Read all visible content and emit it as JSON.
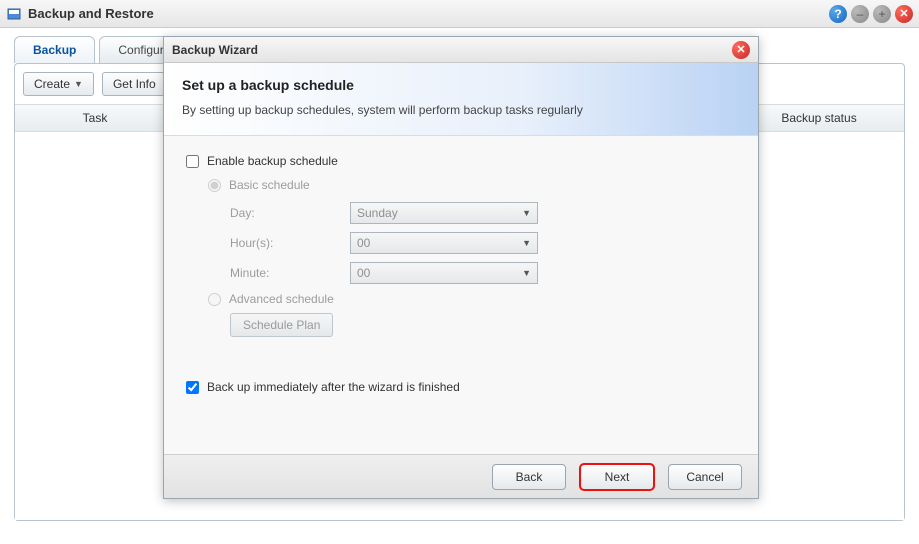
{
  "window": {
    "title": "Backup and Restore"
  },
  "tabs": {
    "backup": "Backup",
    "configure": "Configure"
  },
  "toolbar": {
    "create": "Create",
    "getinfo": "Get Info"
  },
  "table": {
    "col_task": "Task",
    "col_status": "Backup status"
  },
  "wizard": {
    "title": "Backup Wizard",
    "heading": "Set up a backup schedule",
    "subheading": "By setting up backup schedules, system will perform backup tasks regularly",
    "enable_label": "Enable backup schedule",
    "basic_label": "Basic schedule",
    "day_label": "Day:",
    "day_value": "Sunday",
    "hour_label": "Hour(s):",
    "hour_value": "00",
    "minute_label": "Minute:",
    "minute_value": "00",
    "advanced_label": "Advanced schedule",
    "schedule_plan_btn": "Schedule Plan",
    "immediate_label": "Back up immediately after the wizard is finished",
    "back_btn": "Back",
    "next_btn": "Next",
    "cancel_btn": "Cancel"
  }
}
